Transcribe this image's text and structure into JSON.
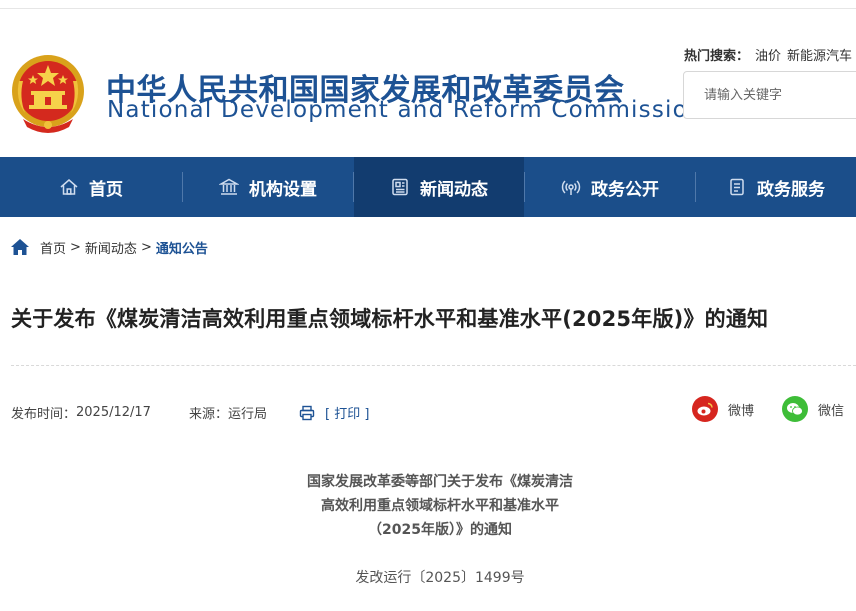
{
  "header": {
    "title_cn": "中华人民共和国国家发展和改革委员会",
    "title_en": "National Development and Reform Commission",
    "hot_label": "热门搜索：",
    "hot_keywords": [
      "油价",
      "新能源汽车"
    ],
    "search_placeholder": "请输入关键字"
  },
  "nav": {
    "items": [
      {
        "label": "首页",
        "icon": "home-outline-icon"
      },
      {
        "label": "机构设置",
        "icon": "building-icon"
      },
      {
        "label": "新闻动态",
        "icon": "newspaper-icon",
        "active": true
      },
      {
        "label": "政务公开",
        "icon": "broadcast-icon"
      },
      {
        "label": "政务服务",
        "icon": "document-icon"
      }
    ]
  },
  "breadcrumb": {
    "items": [
      "首页",
      "新闻动态",
      "通知公告"
    ],
    "separator": ">"
  },
  "article": {
    "title": "关于发布《煤炭清洁高效利用重点领域标杆水平和基准水平(2025年版)》的通知",
    "date_label": "发布时间：",
    "date": "2025/12/17",
    "source_label": "来源：",
    "source": "运行局",
    "print_label": "[ 打印 ]",
    "share": [
      {
        "label": "微博",
        "icon": "weibo-icon",
        "color": "#d6261f"
      },
      {
        "label": "微信",
        "icon": "wechat-icon",
        "color": "#3ebd38"
      }
    ],
    "doc_heading_lines": [
      "国家发展改革委等部门关于发布《煤炭清洁",
      "高效利用重点领域标杆水平和基准水平",
      "（2025年版）》的通知"
    ],
    "doc_number": "发改运行〔2025〕1499号"
  },
  "colors": {
    "brand_blue": "#1d5294",
    "nav_bg": "#1b4e8a",
    "nav_active": "#123c6f"
  }
}
